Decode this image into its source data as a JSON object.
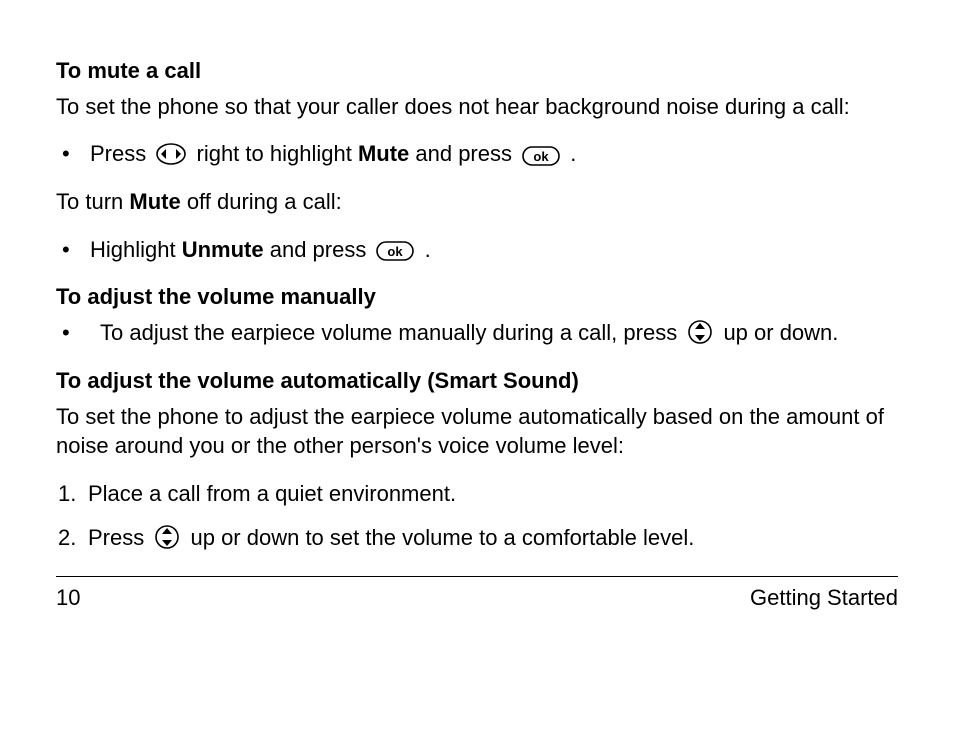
{
  "sec1": {
    "title": "To mute a call",
    "intro": "To set the phone so that your caller does not hear background noise during a call:",
    "b1_a": "Press",
    "b1_b": " right to highlight ",
    "b1_bold": "Mute",
    "b1_c": " and press ",
    "b1_d": " .",
    "mid": "To turn ",
    "mid_bold": "Mute",
    "mid_b": " off during a call:",
    "b2_a": "Highlight ",
    "b2_bold": "Unmute",
    "b2_b": " and press ",
    "b2_c": " ."
  },
  "sec2": {
    "title": "To adjust the volume manually",
    "b1_a": "To adjust the earpiece volume manually during a call, press ",
    "b1_b": " up or down."
  },
  "sec3": {
    "title": "To adjust the volume automatically (Smart Sound)",
    "intro": "To set the phone to adjust the earpiece volume automatically based on the amount of noise around you or the other person's voice volume level:",
    "n1": "Place a call from a quiet environment.",
    "n2_a": "Press ",
    "n2_b": " up or down to set the volume to a comfortable level."
  },
  "footer": {
    "page": "10",
    "section": "Getting Started"
  },
  "bul": "•",
  "num1": "1.",
  "num2": "2."
}
